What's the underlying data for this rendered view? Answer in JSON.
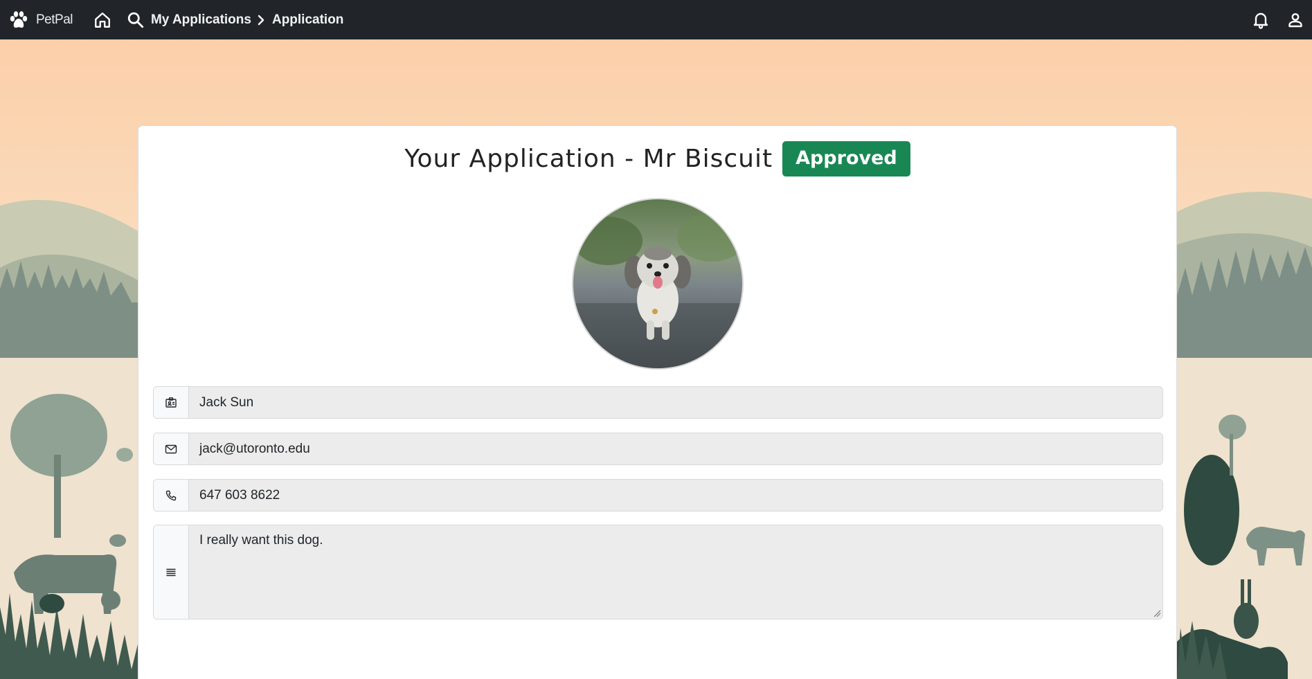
{
  "nav": {
    "brand_name": "PetPal",
    "icons": {
      "brand": "paw-icon",
      "home": "home-icon",
      "search": "search-icon",
      "separator": "chevron-right-icon",
      "notifications": "bell-icon",
      "account": "user-icon"
    },
    "breadcrumb": [
      {
        "label": "My Applications"
      },
      {
        "label": "Application"
      }
    ]
  },
  "application": {
    "title": "Your Application - Mr Biscuit",
    "status": "Approved",
    "pet_photo": "dog-photo",
    "fields": {
      "name": {
        "icon": "id-badge-icon",
        "value": "Jack Sun"
      },
      "email": {
        "icon": "envelope-icon",
        "value": "jack@utoronto.edu"
      },
      "phone": {
        "icon": "phone-icon",
        "value": "647 603 8622"
      },
      "message": {
        "icon": "text-lines-icon",
        "value": "I really want this dog."
      }
    }
  },
  "colors": {
    "navbar": "#212529",
    "approved": "#198754",
    "field_bg": "#ececec",
    "sky_top": "#fbd3b0"
  }
}
